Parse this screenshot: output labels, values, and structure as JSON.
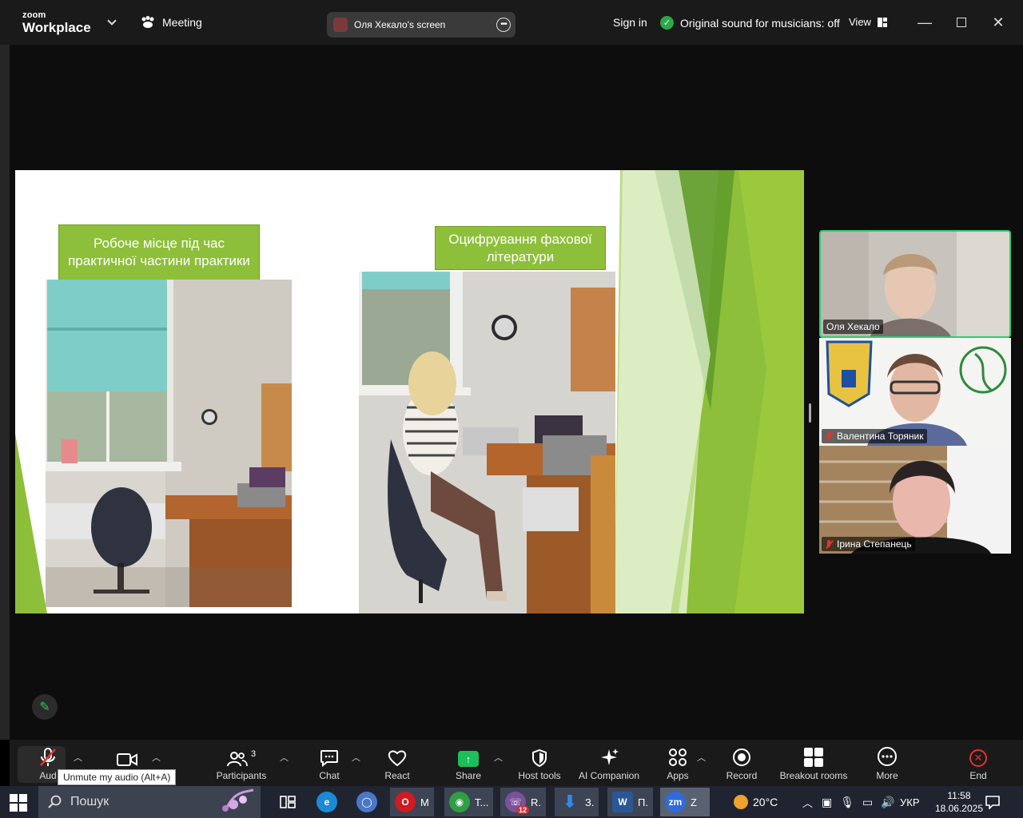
{
  "topbar": {
    "logo_small": "zoom",
    "logo_big": "Workplace",
    "meeting_label": "Meeting",
    "screen_title": "Оля Хекало's screen",
    "sign_in": "Sign in",
    "original_sound": "Original sound for musicians: off",
    "view": "View"
  },
  "slide": {
    "caption_left": "Робоче місце під час практичної частини практики",
    "caption_right": "Оцифрування фахової літератури",
    "accent_color": "#8dbf3a"
  },
  "participants": [
    {
      "name": "Оля Хекало",
      "muted": false
    },
    {
      "name": "Валентина Торяник",
      "muted": true
    },
    {
      "name": "Ірина Степанець",
      "muted": true
    }
  ],
  "toolbar": {
    "audio_label": "Aud",
    "audio_tooltip": "Unmute my audio (Alt+A)",
    "participants_label": "Participants",
    "participants_count": "3",
    "chat_label": "Chat",
    "react_label": "React",
    "share_label": "Share",
    "host_tools_label": "Host tools",
    "ai_label": "AI Companion",
    "apps_label": "Apps",
    "record_label": "Record",
    "breakout_label": "Breakout rooms",
    "more_label": "More",
    "end_label": "End"
  },
  "taskbar": {
    "search_placeholder": "Пошук",
    "apps": [
      {
        "label": "М",
        "icon": "opera-icon"
      },
      {
        "label": "Т...",
        "icon": "chrome-icon"
      },
      {
        "label": "R.",
        "icon": "viber-icon",
        "badge": "12"
      },
      {
        "label": "З.",
        "icon": "download-icon"
      },
      {
        "label": "П.",
        "icon": "word-icon"
      },
      {
        "label": "Z",
        "icon": "zoom-icon"
      }
    ],
    "temperature": "20°C",
    "language": "УКР",
    "time": "11:58",
    "date": "18.06.2025"
  }
}
